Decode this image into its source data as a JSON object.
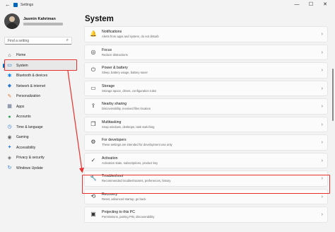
{
  "window": {
    "title": "Settings",
    "back_glyph": "←",
    "controls": [
      "—",
      "☐",
      "✕"
    ]
  },
  "profile": {
    "name": "Jasmin Kahriman"
  },
  "search": {
    "placeholder": "Find a setting",
    "icon": "⌕"
  },
  "sidebar": {
    "items": [
      {
        "label": "Home",
        "icon": "⌂",
        "icon_color": "#444444"
      },
      {
        "label": "System",
        "icon": "▭",
        "icon_color": "#0067c0",
        "selected": true
      },
      {
        "label": "Bluetooth & devices",
        "icon": "✱",
        "icon_color": "#0a84ff"
      },
      {
        "label": "Network & internet",
        "icon": "◆",
        "icon_color": "#2a7bd4"
      },
      {
        "label": "Personalization",
        "icon": "✎",
        "icon_color": "#e07a2e"
      },
      {
        "label": "Apps",
        "icon": "▦",
        "icon_color": "#5a6b8c"
      },
      {
        "label": "Accounts",
        "icon": "●",
        "icon_color": "#2fa35a"
      },
      {
        "label": "Time & language",
        "icon": "◷",
        "icon_color": "#2a7bd4"
      },
      {
        "label": "Gaming",
        "icon": "◉",
        "icon_color": "#666666"
      },
      {
        "label": "Accessibility",
        "icon": "✦",
        "icon_color": "#2a7bd4"
      },
      {
        "label": "Privacy & security",
        "icon": "◈",
        "icon_color": "#666666"
      },
      {
        "label": "Windows Update",
        "icon": "↻",
        "icon_color": "#2a7bd4"
      }
    ]
  },
  "main": {
    "title": "System",
    "chevron": "›",
    "cards": [
      {
        "title": "Notifications",
        "subtitle": "Alerts from apps and system, do not disturb",
        "icon": "🔔"
      },
      {
        "title": "Focus",
        "subtitle": "Reduce distractions",
        "icon": "◎"
      },
      {
        "title": "Power & battery",
        "subtitle": "Sleep, battery usage, battery saver",
        "icon": "⏻"
      },
      {
        "title": "Storage",
        "subtitle": "Storage space, drives, configuration rules",
        "icon": "▭"
      },
      {
        "title": "Nearby sharing",
        "subtitle": "Discoverability, received files location",
        "icon": "⇪"
      },
      {
        "title": "Multitasking",
        "subtitle": "Snap windows, desktops, task switching",
        "icon": "❐"
      },
      {
        "title": "For developers",
        "subtitle": "These settings are intended for development use only",
        "icon": "⚙"
      },
      {
        "title": "Activation",
        "subtitle": "Activation state, subscriptions, product key",
        "icon": "✓"
      },
      {
        "title": "Troubleshoot",
        "subtitle": "Recommended troubleshooters, preferences, history",
        "icon": "🔧"
      },
      {
        "title": "Recovery",
        "subtitle": "Reset, advanced startup, go back",
        "icon": "⟲"
      },
      {
        "title": "Projecting to this PC",
        "subtitle": "Permissions, pairing PIN, discoverability",
        "icon": "▣"
      }
    ]
  },
  "annotation_color": "#e8302e"
}
